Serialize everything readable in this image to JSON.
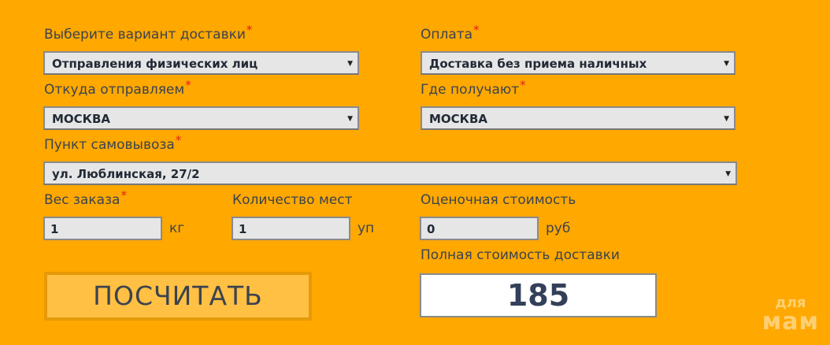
{
  "delivery": {
    "label": "Выберите вариант доставки",
    "value": "Отправления физических лиц"
  },
  "payment": {
    "label": "Оплата",
    "value": "Доставка без приема наличных"
  },
  "from": {
    "label": "Откуда отправляем",
    "value": "МОСКВА"
  },
  "to": {
    "label": "Где получают",
    "value": "МОСКВА"
  },
  "pickup": {
    "label": "Пункт самовывоза",
    "value": "ул. Люблинская, 27/2"
  },
  "weight": {
    "label": "Вес заказа",
    "value": "1",
    "unit": "кг"
  },
  "places": {
    "label": "Количество мест",
    "value": "1",
    "unit": "уп"
  },
  "declared_value": {
    "label": "Оценочная стоимость",
    "value": "0",
    "unit": "руб"
  },
  "total": {
    "label": "Полная стоимость доставки",
    "value": "185"
  },
  "calculate_button": "ПОСЧИТАТЬ",
  "required_mark": "*",
  "watermark": {
    "line1": "для",
    "line2": "мам"
  },
  "colors": {
    "background": "#FFA800",
    "button": "#FFC043",
    "required": "#E0201C"
  }
}
